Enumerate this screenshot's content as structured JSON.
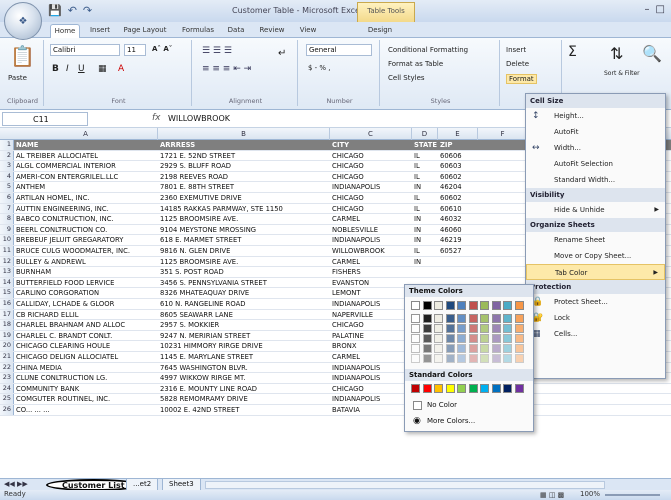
{
  "window": {
    "title": "Customer Table - Microsoft Excel",
    "context_tab": "Table Tools"
  },
  "ribbon_tabs": [
    "Home",
    "Insert",
    "Page Layout",
    "Formulas",
    "Data",
    "Review",
    "View",
    "Design"
  ],
  "ribbon": {
    "clipboard": {
      "paste": "Paste",
      "label": "Clipboard"
    },
    "font": {
      "name": "Calibri",
      "size": "11",
      "label": "Font"
    },
    "alignment": {
      "label": "Alignment"
    },
    "number": {
      "format": "General",
      "dollar": "$ - % ,",
      "label": "Number"
    },
    "styles": {
      "cond": "Conditional Formatting",
      "table": "Format as Table",
      "cell": "Cell Styles",
      "label": "Styles"
    },
    "cells": {
      "insert": "Insert",
      "delete": "Delete",
      "format": "Format"
    },
    "editing": {
      "sort": "Sort & Filter",
      "find": "Find & Select"
    }
  },
  "formula_bar": {
    "name_box": "C11",
    "fx": "fx",
    "value": "WILLOWBROOK"
  },
  "columns": [
    "A",
    "B",
    "C",
    "D",
    "E",
    "F"
  ],
  "headers": [
    "NAME",
    "ARRRESS",
    "CITY",
    "STATE",
    "ZIP"
  ],
  "rows": [
    [
      "AL TREIBER ALLOCIATEL",
      "1721 E. 52ND STREET",
      "CHICAGO",
      "IL",
      "60606"
    ],
    [
      "ALGL COMMERCIAL INTERIOR",
      "2929 S. BLUFF ROAD",
      "CHICAGO",
      "IL",
      "60603"
    ],
    [
      "AMERI-CON ENTERGRILEL.LLC",
      "2198 REEVES ROAD",
      "CHICAGO",
      "IL",
      "60602"
    ],
    [
      "ANTHEM",
      "7801 E. 88TH STREET",
      "INDIANAPOLIS",
      "IN",
      "46204"
    ],
    [
      "ARTILAN HOMEL, INC.",
      "2360 EXEMUTIVE DRIVE",
      "CHICAGO",
      "IL",
      "60602"
    ],
    [
      "AUTTIN ENGINEERING, INC.",
      "14185 RAKKAS PARMWAY, STE 1150",
      "CHICAGO",
      "IL",
      "60610"
    ],
    [
      "BABCO CONLTRUCTION, INC.",
      "1125 BROOMSIRE AVE.",
      "CARMEL",
      "IN",
      "46032"
    ],
    [
      "BEERL CONLTRUCTION CO.",
      "9104 MEYSTONE MROSSING",
      "NOBLESVILLE",
      "IN",
      "46060"
    ],
    [
      "BREBEUF JELUIT GREGARATORY",
      "618 E. MARMET STREET",
      "INDIANAPOLIS",
      "IN",
      "46219"
    ],
    [
      "BRUCE CULG WOODMALTER, INC.",
      "9816 N. GLEN DRIVE",
      "WILLOWBROOK",
      "IL",
      "60527"
    ],
    [
      "BULLEY & ANDREWL",
      "1125 BROOMSIRE AVE.",
      "CARMEL",
      "IN",
      ""
    ],
    [
      "BURNHAM",
      "351 S. POST ROAD",
      "FISHERS",
      "",
      ""
    ],
    [
      "BUTTERFIELD FOOD LERVICE",
      "3456 S. PENNSYLVANIA STREET",
      "EVANSTON",
      "",
      ""
    ],
    [
      "CARLINO CORGORATION",
      "8326 MHATEAQUAY DRIVE",
      "LEMONT",
      "",
      ""
    ],
    [
      "CALLIDAY, LCHADE & GLOOR",
      "610 N. RANGELINE ROAD",
      "INDIANAPOLIS",
      "",
      ""
    ],
    [
      "CB RICHARD ELLIL",
      "8605 SEAWARR LANE",
      "NAPERVILLE",
      "",
      ""
    ],
    [
      "CHARLEL BRAHNAM AND ALLOC",
      "2957 S. MOKKIER",
      "CHICAGO",
      "",
      ""
    ],
    [
      "CHARLEL C. BRANDT CONLT.",
      "9247 N. MERIRIAN STREET",
      "PALATINE",
      "",
      ""
    ],
    [
      "CHICAGO CLEARING HOULE",
      "10231 HIMMORY RIRGE DRIVE",
      "BRONX",
      "",
      ""
    ],
    [
      "CHICAGO DELIGN ALLOCIATEL",
      "1145 E. MARYLANE STREET",
      "CARMEL",
      "",
      ""
    ],
    [
      "CHINA MEDIA",
      "7645 WASHINGTON BLVR.",
      "INDIANAPOLIS",
      "",
      ""
    ],
    [
      "CLUNE CONLTRUCTION LG.",
      "4997 WIKKOW RIRGE MT.",
      "INDIANAPOLIS",
      "",
      ""
    ],
    [
      "COMMUNITY BANK",
      "2316 E. MOUNTY LINE ROAD",
      "CHICAGO",
      "IL",
      "60607"
    ],
    [
      "COMGUTER ROUTINEL, INC.",
      "5828 REMOMRAMY DRIVE",
      "INDIANAPOLIS",
      "IN",
      "46241"
    ],
    [
      "CO... ... ...",
      "10002 E. 42ND STREET",
      "BATAVIA",
      "IL",
      "60510"
    ]
  ],
  "cell_menu": {
    "sections": [
      "Cell Size",
      "Visibility",
      "Organize Sheets",
      "Protection"
    ],
    "items": {
      "height": "Height...",
      "autofit": "AutoFit",
      "width": "Width...",
      "autofit_sel": "AutoFit Selection",
      "std_width": "Standard Width...",
      "hide": "Hide & Unhide",
      "rename": "Rename Sheet",
      "move": "Move or Copy Sheet...",
      "tab": "Tab Color",
      "protect": "Protect Sheet...",
      "lock": "Lock",
      "cells": "Cells..."
    }
  },
  "tab_color": {
    "theme": "Theme Colors",
    "standard": "Standard Colors",
    "no_color": "No Color",
    "more": "More Colors...",
    "theme_row": [
      "#ffffff",
      "#000000",
      "#eeece1",
      "#1f497d",
      "#4f81bd",
      "#c0504d",
      "#9bbb59",
      "#8064a2",
      "#4bacc6",
      "#f79646"
    ],
    "standard_row": [
      "#c00000",
      "#ff0000",
      "#ffc000",
      "#ffff00",
      "#92d050",
      "#00b050",
      "#00b0f0",
      "#0070c0",
      "#002060",
      "#7030a0"
    ]
  },
  "sheet_tabs": [
    "Customer List",
    "...et2",
    "Sheet3"
  ],
  "status": {
    "left": "Ready",
    "zoom": "100%"
  }
}
